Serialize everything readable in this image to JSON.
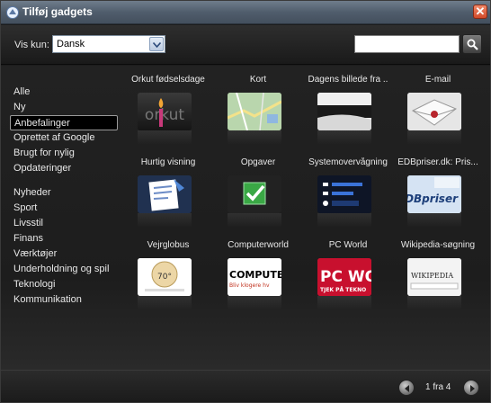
{
  "window": {
    "title": "Tilføj gadgets",
    "close_symbol": "✕"
  },
  "toolbar": {
    "filter_label": "Vis kun:",
    "filter_value": "Dansk",
    "search_value": ""
  },
  "sidebar": {
    "group1": [
      "Alle",
      "Ny",
      "Anbefalinger",
      "Oprettet af Google",
      "Brugt for nylig",
      "Opdateringer"
    ],
    "group2": [
      "Nyheder",
      "Sport",
      "Livsstil",
      "Finans",
      "Værktøjer",
      "Underholdning og spil",
      "Teknologi",
      "Kommunikation"
    ],
    "active": "Anbefalinger"
  },
  "gadgets": [
    {
      "label": "Orkut fødselsdage",
      "thumb_text": "orkut"
    },
    {
      "label": "Kort",
      "thumb_text": ""
    },
    {
      "label": "Dagens billede fra ..",
      "thumb_text": ""
    },
    {
      "label": "E-mail",
      "thumb_text": ""
    },
    {
      "label": "Hurtig visning",
      "thumb_text": ""
    },
    {
      "label": "Opgaver",
      "thumb_text": ""
    },
    {
      "label": "Systemovervågning",
      "thumb_text": ""
    },
    {
      "label": "EDBpriser.dk: Pris...",
      "thumb_text": "EDBpriser"
    },
    {
      "label": "Vejrglobus",
      "thumb_text": "70°"
    },
    {
      "label": "Computerworld",
      "thumb_text": "COMPUTERW",
      "thumb_subtext": "Bliv klogere hv"
    },
    {
      "label": "PC World",
      "thumb_text": "PC WOI",
      "thumb_subtext": "TJEK PÅ TEKNO"
    },
    {
      "label": "Wikipedia-søgning",
      "thumb_text": "WIKIPEDIA"
    }
  ],
  "pager": {
    "text": "1 fra 4"
  },
  "colors": {
    "accent_orange": "#d24a2a",
    "pcworld_red": "#c8102e",
    "task_green": "#3aa845"
  }
}
